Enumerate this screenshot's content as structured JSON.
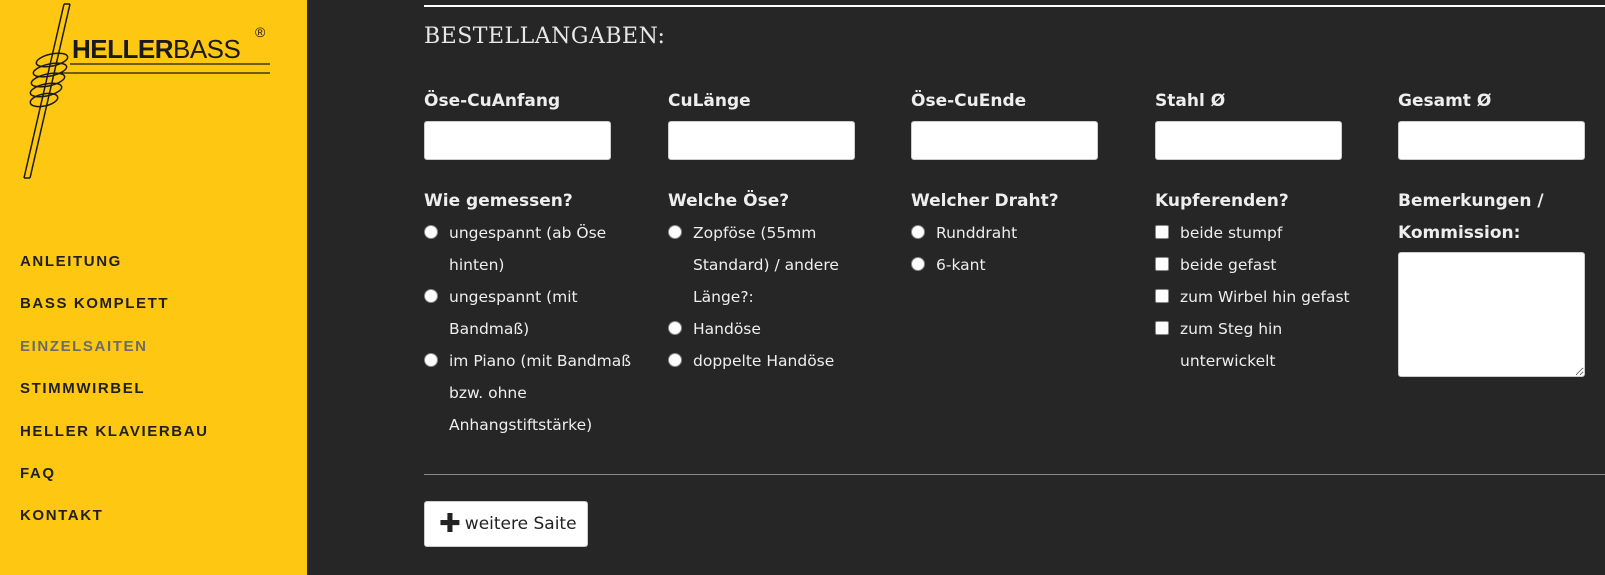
{
  "brand": {
    "logo_bold": "HELLER",
    "logo_light": "BASS",
    "logo_reg": "®"
  },
  "nav": {
    "items": [
      {
        "label": "ANLEITUNG"
      },
      {
        "label": "BASS KOMPLETT"
      },
      {
        "label": "EINZELSAITEN"
      },
      {
        "label": "STIMMWIRBEL"
      },
      {
        "label": "HELLER KLAVIERBAU"
      },
      {
        "label": "FAQ"
      },
      {
        "label": "KONTAKT"
      }
    ],
    "active_index": 2
  },
  "form": {
    "title": "BESTELLANGABEN:",
    "fields": [
      {
        "label": "Öse-CuAnfang",
        "value": ""
      },
      {
        "label": "CuLänge",
        "value": ""
      },
      {
        "label": "Öse-CuEnde",
        "value": ""
      },
      {
        "label": "Stahl Ø",
        "value": ""
      },
      {
        "label": "Gesamt Ø",
        "value": ""
      }
    ],
    "measured": {
      "label": "Wie gemessen?",
      "options": [
        "ungespannt (ab Öse hinten)",
        "ungespannt (mit Bandmaß)",
        "im Piano (mit Bandmaß bzw. ohne Anhangstiftstärke)"
      ]
    },
    "eyelet": {
      "label": "Welche Öse?",
      "options": [
        "Zopföse (55mm Standard) / andere Länge?:",
        "Handöse",
        "doppelte Handöse"
      ]
    },
    "wire": {
      "label": "Welcher Draht?",
      "options": [
        "Runddraht",
        "6-kant"
      ]
    },
    "copper_ends": {
      "label": "Kupferenden?",
      "options": [
        "beide stumpf",
        "beide gefast",
        "zum Wirbel hin gefast",
        "zum Steg hin unterwickelt"
      ]
    },
    "remarks": {
      "label": "Bemerkungen / Kommission:",
      "value": ""
    },
    "add_button": {
      "icon": "plus-icon",
      "label": "weitere Saite"
    }
  },
  "colors": {
    "sidebar_bg": "#fec712",
    "main_bg": "#262626",
    "nav_active": "#6b6b6b"
  }
}
